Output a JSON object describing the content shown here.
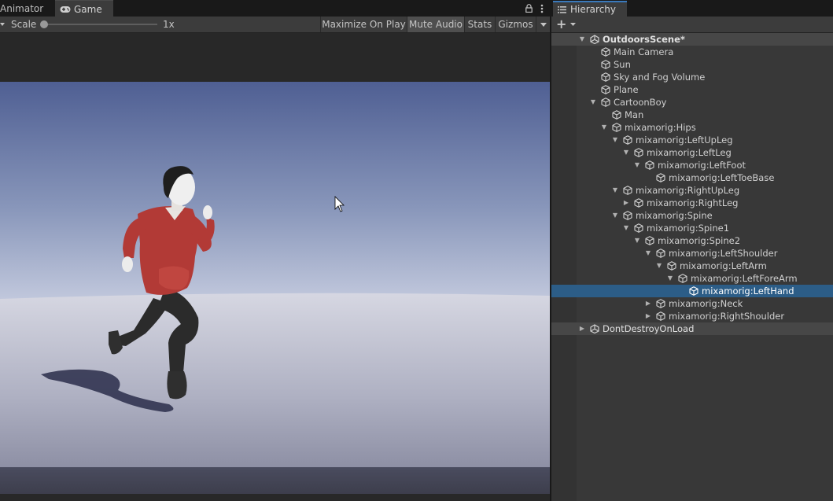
{
  "game_tabs": {
    "animator": "Animator",
    "game": "Game"
  },
  "game_toolbar": {
    "scale_label": "Scale",
    "scale_value": "1x",
    "maximize": "Maximize On Play",
    "mute": "Mute Audio",
    "stats": "Stats",
    "gizmos": "Gizmos"
  },
  "hierarchy": {
    "tab": "Hierarchy",
    "add": "+",
    "rows": [
      {
        "label": "OutdoorsScene*",
        "depth": 0,
        "arrow": "down",
        "icon": "unity-scene-icon",
        "type": "scene"
      },
      {
        "label": "Main Camera",
        "depth": 1,
        "arrow": "none",
        "icon": "cube-icon",
        "type": "object"
      },
      {
        "label": "Sun",
        "depth": 1,
        "arrow": "none",
        "icon": "cube-icon",
        "type": "object"
      },
      {
        "label": "Sky and Fog Volume",
        "depth": 1,
        "arrow": "none",
        "icon": "cube-icon",
        "type": "object"
      },
      {
        "label": "Plane",
        "depth": 1,
        "arrow": "none",
        "icon": "cube-icon",
        "type": "object"
      },
      {
        "label": "CartoonBoy",
        "depth": 1,
        "arrow": "down",
        "icon": "cube-icon",
        "type": "object"
      },
      {
        "label": "Man",
        "depth": 2,
        "arrow": "none",
        "icon": "cube-icon",
        "type": "object"
      },
      {
        "label": "mixamorig:Hips",
        "depth": 2,
        "arrow": "down",
        "icon": "cube-icon",
        "type": "object"
      },
      {
        "label": "mixamorig:LeftUpLeg",
        "depth": 3,
        "arrow": "down",
        "icon": "cube-icon",
        "type": "object"
      },
      {
        "label": "mixamorig:LeftLeg",
        "depth": 4,
        "arrow": "down",
        "icon": "cube-icon",
        "type": "object"
      },
      {
        "label": "mixamorig:LeftFoot",
        "depth": 5,
        "arrow": "down",
        "icon": "cube-icon",
        "type": "object"
      },
      {
        "label": "mixamorig:LeftToeBase",
        "depth": 6,
        "arrow": "none",
        "icon": "cube-icon",
        "type": "object"
      },
      {
        "label": "mixamorig:RightUpLeg",
        "depth": 3,
        "arrow": "down",
        "icon": "cube-icon",
        "type": "object"
      },
      {
        "label": "mixamorig:RightLeg",
        "depth": 4,
        "arrow": "right",
        "icon": "cube-icon",
        "type": "object"
      },
      {
        "label": "mixamorig:Spine",
        "depth": 3,
        "arrow": "down",
        "icon": "cube-icon",
        "type": "object"
      },
      {
        "label": "mixamorig:Spine1",
        "depth": 4,
        "arrow": "down",
        "icon": "cube-icon",
        "type": "object"
      },
      {
        "label": "mixamorig:Spine2",
        "depth": 5,
        "arrow": "down",
        "icon": "cube-icon",
        "type": "object"
      },
      {
        "label": "mixamorig:LeftShoulder",
        "depth": 6,
        "arrow": "down",
        "icon": "cube-icon",
        "type": "object"
      },
      {
        "label": "mixamorig:LeftArm",
        "depth": 7,
        "arrow": "down",
        "icon": "cube-icon",
        "type": "object"
      },
      {
        "label": "mixamorig:LeftForeArm",
        "depth": 8,
        "arrow": "down",
        "icon": "cube-icon",
        "type": "object"
      },
      {
        "label": "mixamorig:LeftHand",
        "depth": 9,
        "arrow": "none",
        "icon": "cube-icon",
        "type": "selected"
      },
      {
        "label": "mixamorig:Neck",
        "depth": 6,
        "arrow": "right",
        "icon": "cube-icon",
        "type": "object"
      },
      {
        "label": "mixamorig:RightShoulder",
        "depth": 6,
        "arrow": "right",
        "icon": "cube-icon",
        "type": "object"
      },
      {
        "label": "DontDestroyOnLoad",
        "depth": 0,
        "arrow": "right",
        "icon": "unity-scene-icon",
        "type": "scene2"
      }
    ]
  },
  "colors": {
    "selection": "#2c5d87",
    "accent_tab": "#3a79bb",
    "panel_bg": "#383838",
    "toolbar_bg": "#3c3c3c",
    "character_shirt": "#b23a36",
    "character_pants": "#2b2b2b"
  }
}
